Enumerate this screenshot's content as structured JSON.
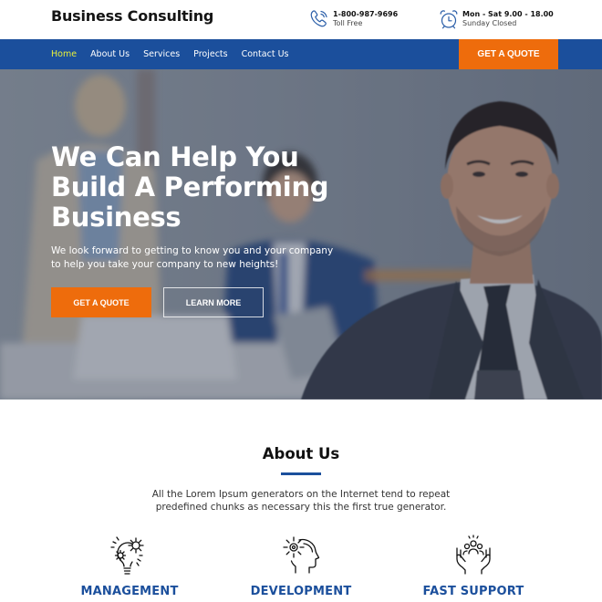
{
  "header": {
    "brand": "Business Consulting",
    "phone": {
      "icon": "phone-icon",
      "number": "1-800-987-9696",
      "label": "Toll Free"
    },
    "hours": {
      "icon": "alarm-clock-icon",
      "schedule": "Mon - Sat 9.00 - 18.00",
      "label": "Sunday Closed"
    }
  },
  "nav": {
    "items": [
      {
        "label": "Home",
        "active": true
      },
      {
        "label": "About Us",
        "active": false
      },
      {
        "label": "Services",
        "active": false
      },
      {
        "label": "Projects",
        "active": false
      },
      {
        "label": "Contact Us",
        "active": false
      }
    ],
    "quote_button": "GET A QUOTE"
  },
  "hero": {
    "title": "We Can Help You Build A Performing Business",
    "subtitle": "We look forward to getting to know you and your company to help you take your company to new heights!",
    "primary_button": "GET A QUOTE",
    "secondary_button": "LEARN MORE"
  },
  "about": {
    "title": "About Us",
    "text": "All the Lorem Ipsum generators on the Internet tend to repeat predefined chunks as necessary this the first true generator.",
    "features": [
      {
        "icon": "lightbulb-gears-icon",
        "label": "MANAGEMENT"
      },
      {
        "icon": "head-gear-icon",
        "label": "DEVELOPMENT"
      },
      {
        "icon": "hands-team-icon",
        "label": "FAST SUPPORT"
      }
    ]
  },
  "colors": {
    "primary_blue": "#1b4f9c",
    "accent_orange": "#ee6c0c",
    "nav_active": "#e8f03a"
  }
}
